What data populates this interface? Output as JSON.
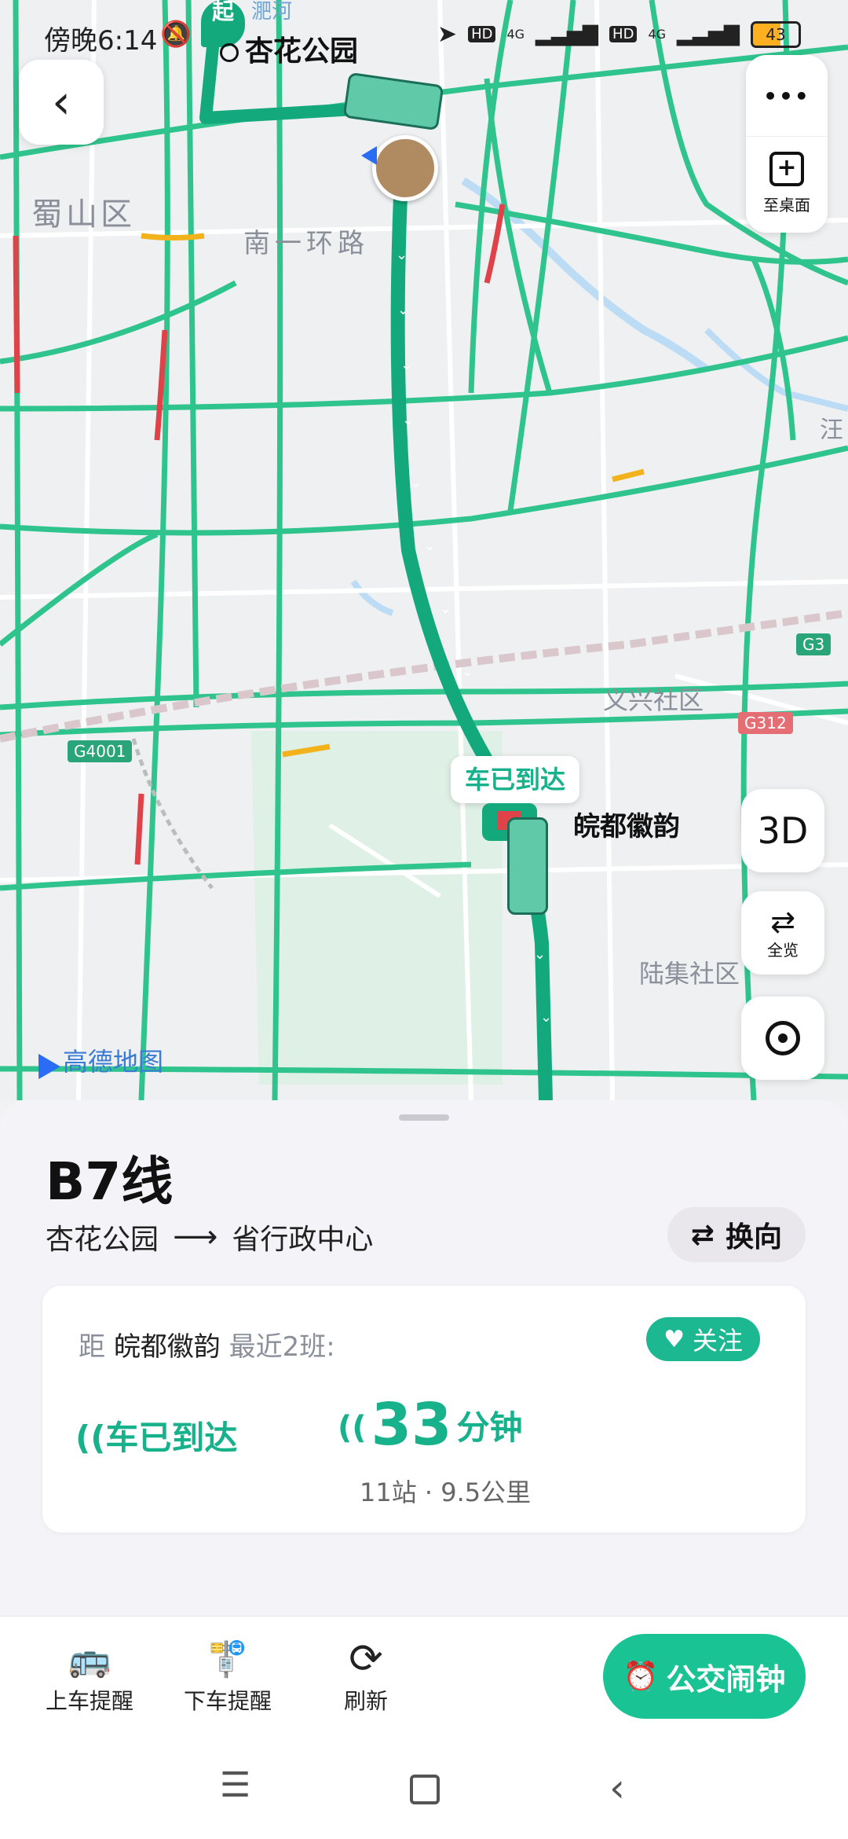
{
  "status_bar": {
    "time": "傍晚6:14",
    "battery": "43",
    "net1": "4G",
    "net2": "4G",
    "hd1": "HD",
    "hd2": "HD"
  },
  "map": {
    "start_marker": "起",
    "start_station": "杏花公园",
    "river_label": "淝河",
    "district_label": "蜀山区",
    "road_label": "南一环路",
    "place_labels": [
      "义兴社区",
      "陆集社区",
      "汪"
    ],
    "highway_labels": [
      "G3",
      "G312",
      "G4001"
    ],
    "bus_arrived_bubble": "车已到达",
    "stop_name": "皖都徽韵",
    "watermark": "高德地图",
    "more_button": "•••",
    "to_desktop": "至桌面",
    "btn_3d": "3D",
    "overview": "全览",
    "colors": {
      "route": "#17b18c",
      "road": "#2fc48d",
      "congestion": "#e0424a",
      "slow": "#f2b21c"
    }
  },
  "panel": {
    "line_name": "B7线",
    "from": "杏花公园",
    "to": "省行政中心",
    "swap_label": "换向",
    "distance_prefix": "距",
    "distance_stop": "皖都徽韵",
    "distance_suffix": "最近2班:",
    "follow_label": "关注",
    "bus1_status": "车已到达",
    "bus2_minutes": "33",
    "bus2_unit": "分钟",
    "bus2_detail": "11站 · 9.5公里"
  },
  "toolbar": {
    "board_alert": "上车提醒",
    "alight_alert": "下车提醒",
    "refresh": "刷新",
    "alarm": "公交闹钟"
  }
}
